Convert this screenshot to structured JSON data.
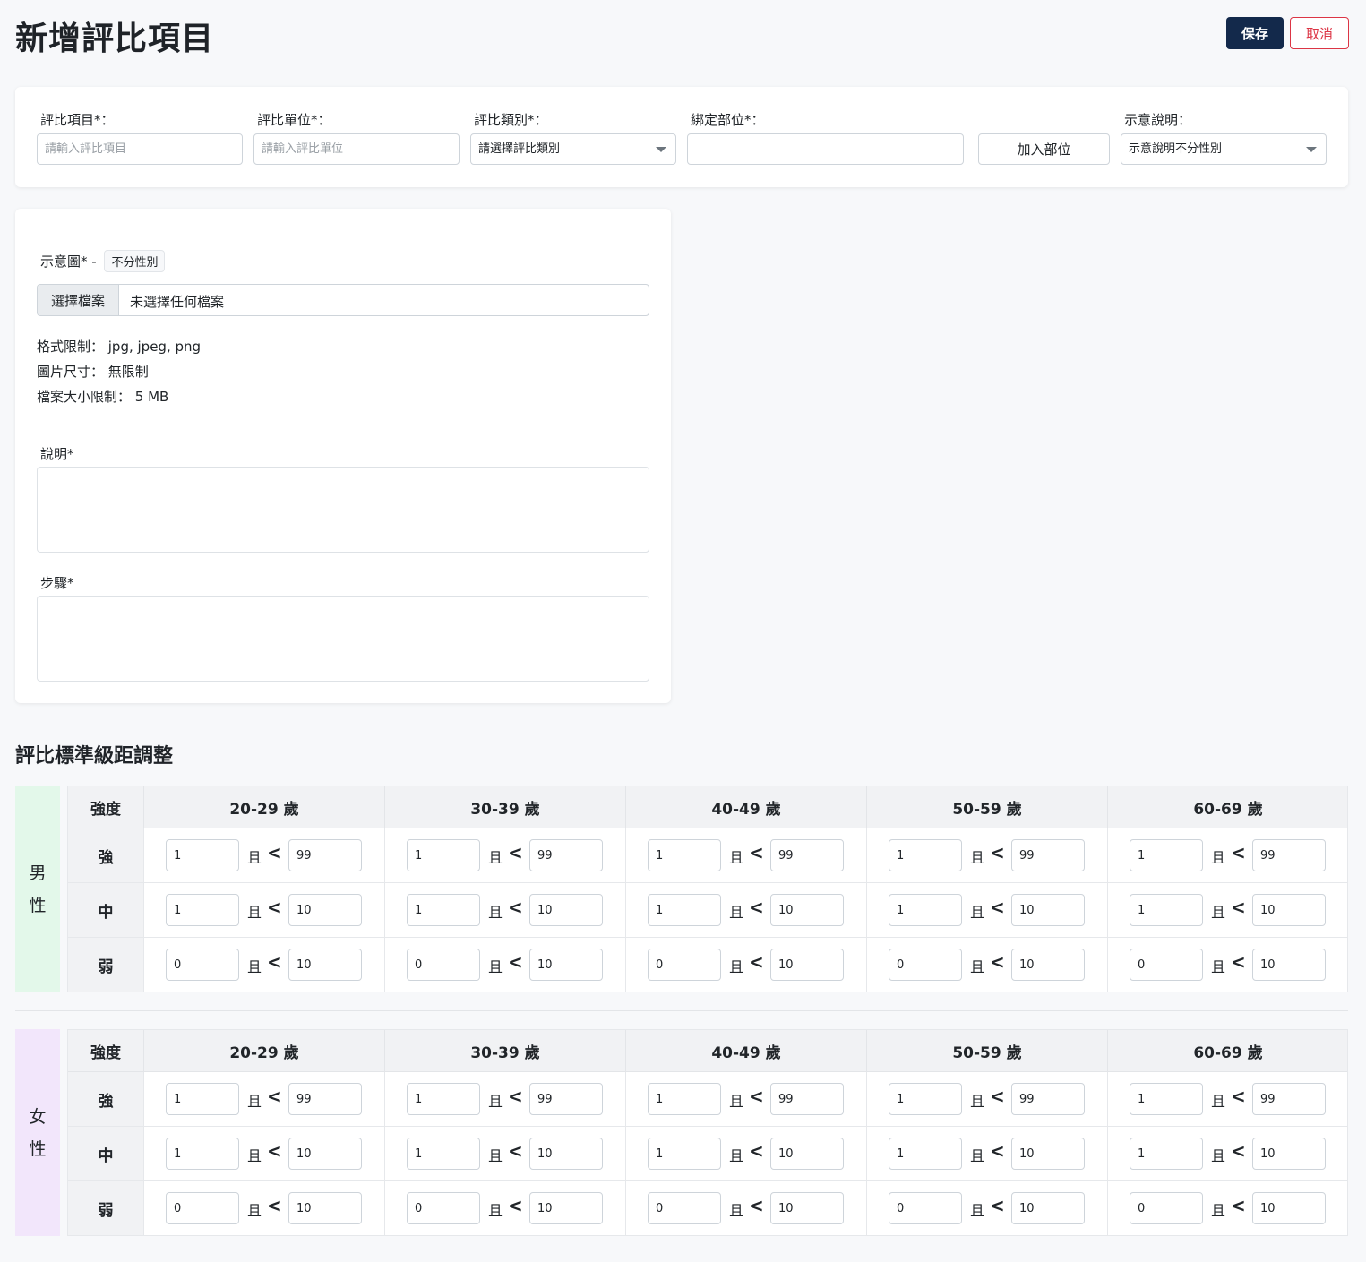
{
  "header": {
    "title": "新增評比項目",
    "save_label": "保存",
    "cancel_label": "取消"
  },
  "top_form": {
    "item_label": "評比項目*：",
    "item_placeholder": "請輸入評比項目",
    "unit_label": "評比單位*：",
    "unit_placeholder": "請輸入評比單位",
    "category_label": "評比類別*：",
    "category_value": "請選擇評比類別",
    "bind_label": "綁定部位*：",
    "bind_value": "",
    "add_part_label": "加入部位",
    "illustration_label": "示意說明：",
    "illustration_value": "示意說明不分性別"
  },
  "media_form": {
    "image_label": "示意圖* -",
    "gender_tag": "不分性別",
    "choose_file_label": "選擇檔案",
    "no_file_text": "未選擇任何檔案",
    "format_limit": "格式限制： jpg, jpeg, png",
    "size_limit": "圖片尺寸： 無限制",
    "file_size_limit": "檔案大小限制： 5 MB",
    "description_label": "說明*",
    "steps_label": "步驟*"
  },
  "grading": {
    "title": "評比標準級距調整",
    "intensity_header": "強度",
    "and_text": "且",
    "lt_text": "<",
    "age_groups": [
      "20-29 歲",
      "30-39 歲",
      "40-49 歲",
      "50-59 歲",
      "60-69 歲"
    ],
    "levels": [
      "強",
      "中",
      "弱"
    ],
    "colors": {
      "male_bg": "#e3f8ea",
      "female_bg": "#f2e6fb"
    },
    "genders": [
      {
        "label_chars": [
          "男",
          "性"
        ],
        "rows": [
          {
            "min": [
              "1",
              "1",
              "1",
              "1",
              "1"
            ],
            "max": [
              "99",
              "99",
              "99",
              "99",
              "99"
            ]
          },
          {
            "min": [
              "1",
              "1",
              "1",
              "1",
              "1"
            ],
            "max": [
              "10",
              "10",
              "10",
              "10",
              "10"
            ]
          },
          {
            "min": [
              "0",
              "0",
              "0",
              "0",
              "0"
            ],
            "max": [
              "10",
              "10",
              "10",
              "10",
              "10"
            ]
          }
        ]
      },
      {
        "label_chars": [
          "女",
          "性"
        ],
        "rows": [
          {
            "min": [
              "1",
              "1",
              "1",
              "1",
              "1"
            ],
            "max": [
              "99",
              "99",
              "99",
              "99",
              "99"
            ]
          },
          {
            "min": [
              "1",
              "1",
              "1",
              "1",
              "1"
            ],
            "max": [
              "10",
              "10",
              "10",
              "10",
              "10"
            ]
          },
          {
            "min": [
              "0",
              "0",
              "0",
              "0",
              "0"
            ],
            "max": [
              "10",
              "10",
              "10",
              "10",
              "10"
            ]
          }
        ]
      }
    ]
  }
}
